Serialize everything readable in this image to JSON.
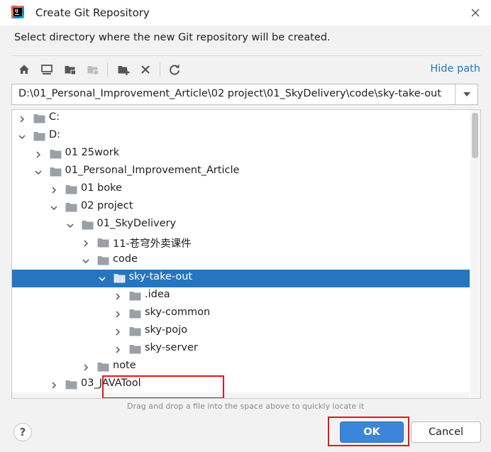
{
  "window": {
    "title": "Create Git Repository"
  },
  "description": "Select directory where the new Git repository will be created.",
  "toolbar": {
    "buttons": [
      "home-icon",
      "desktop-icon",
      "project-folder-icon",
      "module-folder-icon",
      "new-folder-icon",
      "delete-icon",
      "refresh-icon"
    ],
    "hide_path": "Hide path"
  },
  "path": {
    "value": "D:\\01_Personal_Improvement_Article\\02 project\\01_SkyDelivery\\code\\sky-take-out"
  },
  "tree": {
    "rows": [
      {
        "label": "C:",
        "expanded": false
      },
      {
        "label": "D:",
        "expanded": true
      },
      {
        "label": "01 25work",
        "expanded": false
      },
      {
        "label": "01_Personal_Improvement_Article",
        "expanded": true
      },
      {
        "label": "01 boke",
        "expanded": false
      },
      {
        "label": "02 project",
        "expanded": true
      },
      {
        "label": "01_SkyDelivery",
        "expanded": true
      },
      {
        "label": "11-苍穹外卖课件",
        "expanded": false
      },
      {
        "label": "code",
        "expanded": true
      },
      {
        "label": "sky-take-out",
        "expanded": true,
        "selected": true
      },
      {
        "label": ".idea",
        "expanded": false
      },
      {
        "label": "sky-common",
        "expanded": false
      },
      {
        "label": "sky-pojo",
        "expanded": false
      },
      {
        "label": "sky-server",
        "expanded": false
      },
      {
        "label": "note",
        "expanded": false
      },
      {
        "label": "03_JAVATool",
        "expanded": false
      }
    ]
  },
  "hint": "Drag and drop a file into the space above to quickly locate it",
  "buttons": {
    "help": "?",
    "ok": "OK",
    "cancel": "Cancel"
  },
  "colors": {
    "selection": "#2675bf",
    "accent": "#3b86d8",
    "highlight": "#e3161d"
  }
}
